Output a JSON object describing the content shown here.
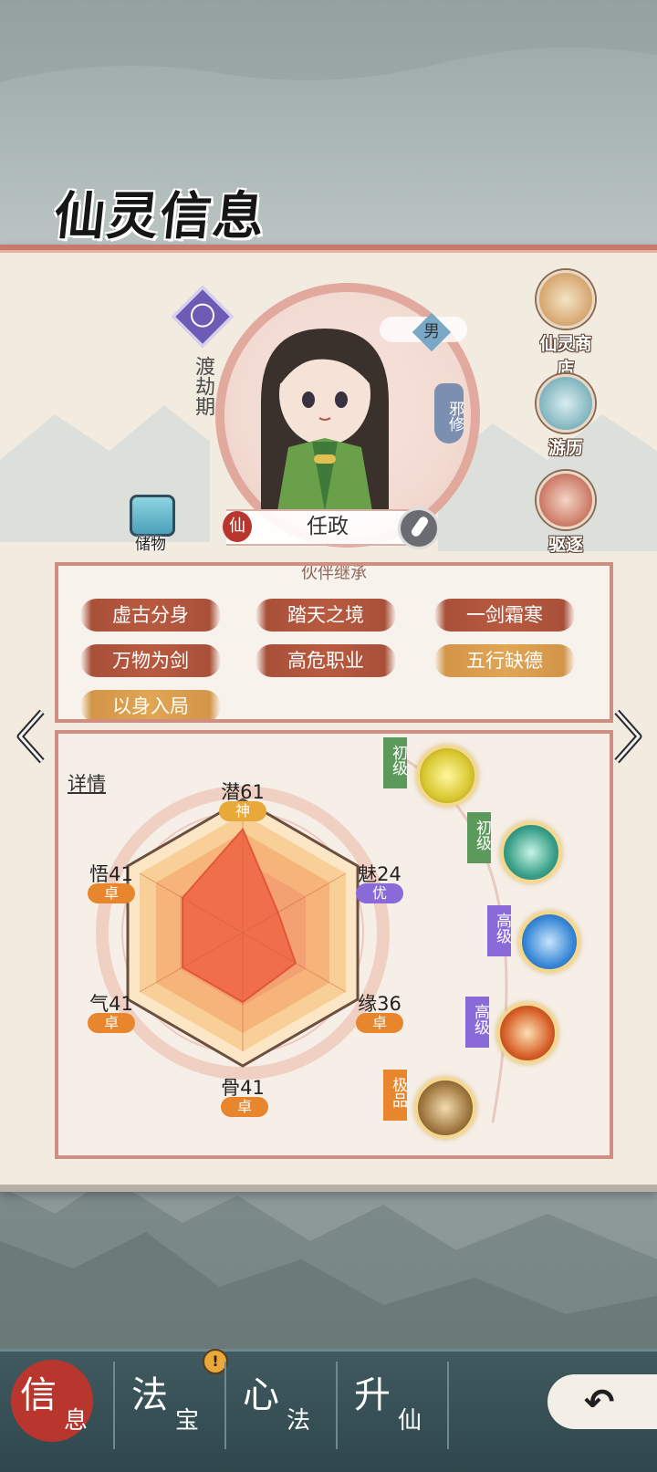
{
  "title": "仙灵信息",
  "character": {
    "realm": "渡劫期",
    "gender": "男",
    "path": "邪修",
    "name": "任政",
    "seal": "仙"
  },
  "storage_label": "储物",
  "side_buttons": [
    {
      "label": "仙灵商店",
      "icon": "shop-icon"
    },
    {
      "label": "游历",
      "icon": "travel-icon"
    },
    {
      "label": "驱逐",
      "icon": "expel-icon"
    }
  ],
  "traits": {
    "heading": "伙伴继承",
    "items": [
      {
        "label": "虚古分身",
        "color": "#b85a40"
      },
      {
        "label": "踏天之境",
        "color": "#b85a40"
      },
      {
        "label": "一剑霜寒",
        "color": "#b85a40"
      },
      {
        "label": "万物为剑",
        "color": "#b85a40"
      },
      {
        "label": "高危职业",
        "color": "#b85a40"
      },
      {
        "label": "五行缺德",
        "color": "#e0a654"
      },
      {
        "label": "以身入局",
        "color": "#e0a654"
      }
    ]
  },
  "details_label": "详情",
  "stats": [
    {
      "name": "潜",
      "value": 61,
      "label": "潜61",
      "tag": "神",
      "tag_color": "#e8a93a"
    },
    {
      "name": "魅",
      "value": 24,
      "label": "魅24",
      "tag": "优",
      "tag_color": "#8a6ad8"
    },
    {
      "name": "缘",
      "value": 36,
      "label": "缘36",
      "tag": "卓",
      "tag_color": "#e8862e"
    },
    {
      "name": "骨",
      "value": 41,
      "label": "骨41",
      "tag": "卓",
      "tag_color": "#e8862e"
    },
    {
      "name": "气",
      "value": 41,
      "label": "气41",
      "tag": "卓",
      "tag_color": "#e8862e"
    },
    {
      "name": "悟",
      "value": 41,
      "label": "悟41",
      "tag": "卓",
      "tag_color": "#e8862e"
    }
  ],
  "elements": [
    {
      "grade": "初级",
      "grade_color": "#5c9a5c",
      "element": "metal-icon",
      "color": "#d8c830"
    },
    {
      "grade": "初级",
      "grade_color": "#5c9a5c",
      "element": "wood-icon",
      "color": "#3aa08a"
    },
    {
      "grade": "高级",
      "grade_color": "#8a6ad8",
      "element": "water-icon",
      "color": "#3a8ad8"
    },
    {
      "grade": "高级",
      "grade_color": "#8a6ad8",
      "element": "fire-icon",
      "color": "#d8602a"
    },
    {
      "grade": "极品",
      "grade_color": "#e8862e",
      "element": "earth-icon",
      "color": "#a07840"
    }
  ],
  "nav": [
    {
      "big": "信",
      "small": "息",
      "active": true
    },
    {
      "big": "法",
      "small": "宝",
      "active": false
    },
    {
      "big": "心",
      "small": "法",
      "active": false
    },
    {
      "big": "升",
      "small": "仙",
      "active": false
    }
  ],
  "alert_badge": "!"
}
